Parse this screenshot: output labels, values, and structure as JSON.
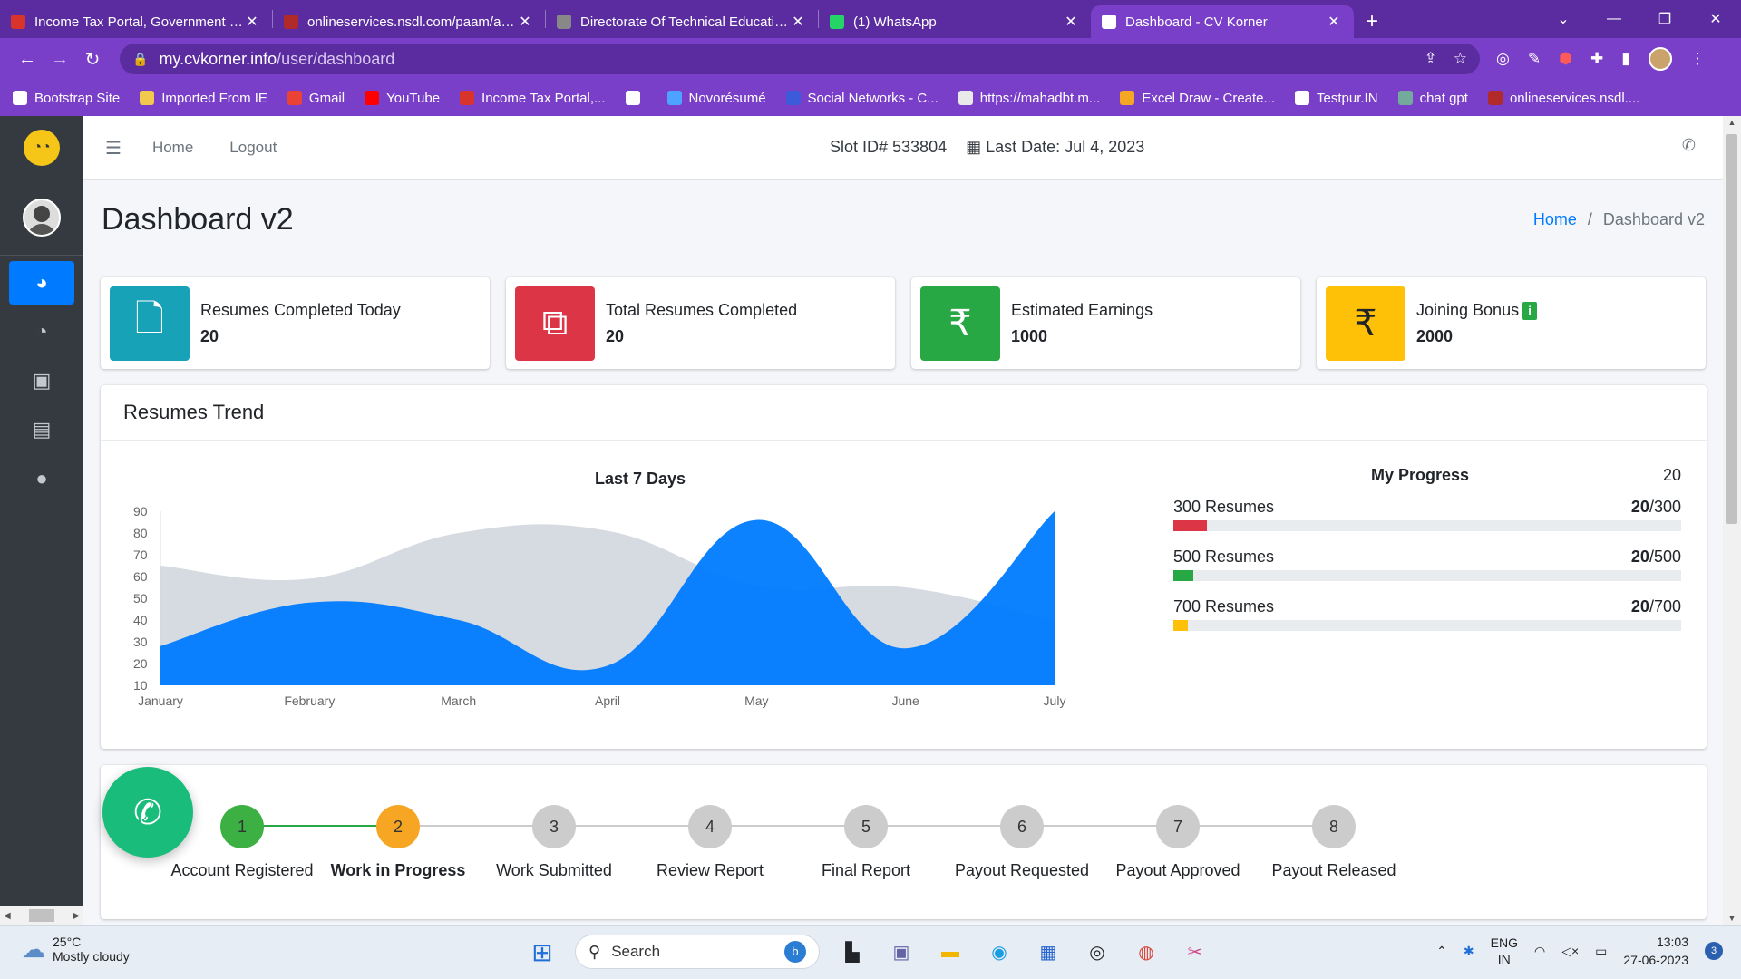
{
  "browser": {
    "tabs": [
      {
        "title": "Income Tax Portal, Government of India",
        "color": "#d9342b"
      },
      {
        "title": "onlineservices.nsdl.com/paam/auth",
        "color": "#b02a2a"
      },
      {
        "title": "Directorate Of Technical Education",
        "color": "#888888"
      },
      {
        "title": "(1) WhatsApp",
        "color": "#25d366"
      },
      {
        "title": "Dashboard - CV Korner",
        "color": "#ffffff"
      }
    ],
    "url_host": "my.cvkorner.info",
    "url_path": "/user/dashboard",
    "bookmarks": [
      {
        "label": "Bootstrap Site",
        "color": "#ffffff"
      },
      {
        "label": "Imported From IE",
        "color": "#f2c94c"
      },
      {
        "label": "Gmail",
        "color": "#ea4335"
      },
      {
        "label": "YouTube",
        "color": "#ff0000"
      },
      {
        "label": "Income Tax Portal,...",
        "color": "#d9342b"
      },
      {
        "label": "",
        "color": "#ffffff"
      },
      {
        "label": "Novorésumé",
        "color": "#4da3ff"
      },
      {
        "label": "Social Networks - C...",
        "color": "#3b5bdb"
      },
      {
        "label": "https://mahadbt.m...",
        "color": "#e9e9e9"
      },
      {
        "label": "Excel Draw - Create...",
        "color": "#f5a623"
      },
      {
        "label": "Testpur.IN",
        "color": "#ffffff"
      },
      {
        "label": "chat gpt",
        "color": "#74aa9c"
      },
      {
        "label": "onlineservices.nsdl....",
        "color": "#b02a2a"
      }
    ]
  },
  "nav": {
    "home": "Home",
    "logout": "Logout",
    "slot": "Slot ID# 533804",
    "last_date": "Last Date: Jul 4, 2023"
  },
  "page": {
    "title": "Dashboard v2",
    "breadcrumb_home": "Home",
    "breadcrumb_current": "Dashboard v2"
  },
  "info_boxes": [
    {
      "label": "Resumes Completed Today",
      "value": "20",
      "color": "#17a2b8",
      "icon": "file-icon"
    },
    {
      "label": "Total Resumes Completed",
      "value": "20",
      "color": "#dc3545",
      "icon": "copy-icon"
    },
    {
      "label": "Estimated Earnings",
      "value": "1000",
      "color": "#28a745",
      "icon": "rupee-icon"
    },
    {
      "label": "Joining Bonus",
      "value": "2000",
      "color": "#ffc107",
      "icon": "rupee-icon"
    }
  ],
  "trend_card": {
    "title": "Resumes Trend",
    "chart_title": "Last 7 Days",
    "progress_title": "My Progress",
    "progress_count": "20"
  },
  "chart_data": {
    "type": "area",
    "title": "Last 7 Days",
    "categories": [
      "January",
      "February",
      "March",
      "April",
      "May",
      "June",
      "July"
    ],
    "ylim": [
      10,
      90
    ],
    "yticks": [
      10,
      20,
      30,
      40,
      50,
      60,
      70,
      80,
      90
    ],
    "series": [
      {
        "values": [
          65,
          59,
          80,
          81,
          56,
          55,
          40
        ],
        "color": "#d2d6de"
      },
      {
        "values": [
          28,
          48,
          40,
          19,
          86,
          27,
          90
        ],
        "color": "#007bff"
      }
    ]
  },
  "progress": [
    {
      "label": "300 Resumes",
      "done": "20",
      "total": "/300",
      "fraction": 0.0667,
      "color": "#dc3545"
    },
    {
      "label": "500 Resumes",
      "done": "20",
      "total": "/500",
      "fraction": 0.04,
      "color": "#28a745"
    },
    {
      "label": "700 Resumes",
      "done": "20",
      "total": "/700",
      "fraction": 0.0286,
      "color": "#ffc107"
    }
  ],
  "steps": [
    {
      "num": "1",
      "label": "Account Registered",
      "state": "done"
    },
    {
      "num": "2",
      "label": "Work in Progress",
      "state": "current"
    },
    {
      "num": "3",
      "label": "Work Submitted",
      "state": "todo"
    },
    {
      "num": "4",
      "label": "Review Report",
      "state": "todo"
    },
    {
      "num": "5",
      "label": "Final Report",
      "state": "todo"
    },
    {
      "num": "6",
      "label": "Payout Requested",
      "state": "todo"
    },
    {
      "num": "7",
      "label": "Payout Approved",
      "state": "todo"
    },
    {
      "num": "8",
      "label": "Payout Released",
      "state": "todo"
    }
  ],
  "taskbar": {
    "temp": "25°C",
    "weather": "Mostly cloudy",
    "search": "Search",
    "lang_1": "ENG",
    "lang_2": "IN",
    "time": "13:03",
    "date": "27-06-2023",
    "notifications": "3"
  }
}
